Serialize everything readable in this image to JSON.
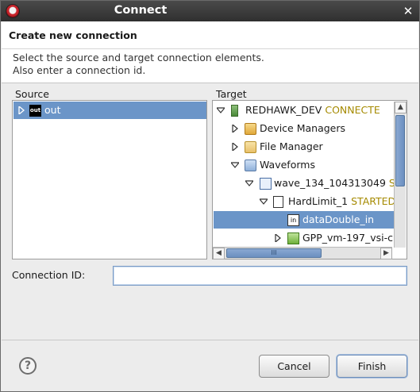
{
  "window": {
    "title": "Connect",
    "close_glyph": "✕"
  },
  "header": {
    "title": "Create new connection",
    "message_line1": "Select the source and target connection elements.",
    "message_line2": "Also enter a connection id."
  },
  "source": {
    "label": "Source",
    "items": [
      {
        "label": "out",
        "icon": "port-out-icon",
        "icon_text": "out",
        "selected": true
      }
    ]
  },
  "target": {
    "label": "Target",
    "items": [
      {
        "label": "REDHAWK_DEV",
        "state": "CONNECTE",
        "icon": "domain-icon"
      },
      {
        "label": "Device Managers",
        "icon": "folder-icon"
      },
      {
        "label": "File Manager",
        "icon": "folder-icon"
      },
      {
        "label": "Waveforms",
        "icon": "folder-open-icon"
      },
      {
        "label": "wave_134_104313049",
        "state": "ST",
        "icon": "waveform-icon"
      },
      {
        "label": "HardLimit_1",
        "state": "STARTED",
        "icon": "component-icon"
      },
      {
        "label": "dataDouble_in",
        "icon": "port-in-icon",
        "icon_text": "in",
        "selected": true
      },
      {
        "label": "GPP_vm-197_vsi-c",
        "icon": "device-icon"
      }
    ],
    "scroll_h_grip": "III"
  },
  "connection_id": {
    "label": "Connection ID:",
    "value": "",
    "placeholder": ""
  },
  "buttons": {
    "help": "?",
    "cancel": "Cancel",
    "finish": "Finish"
  },
  "colors": {
    "selection": "#6b95c8",
    "state_text": "#a58a00",
    "titlebar": "#3a3a3a"
  }
}
